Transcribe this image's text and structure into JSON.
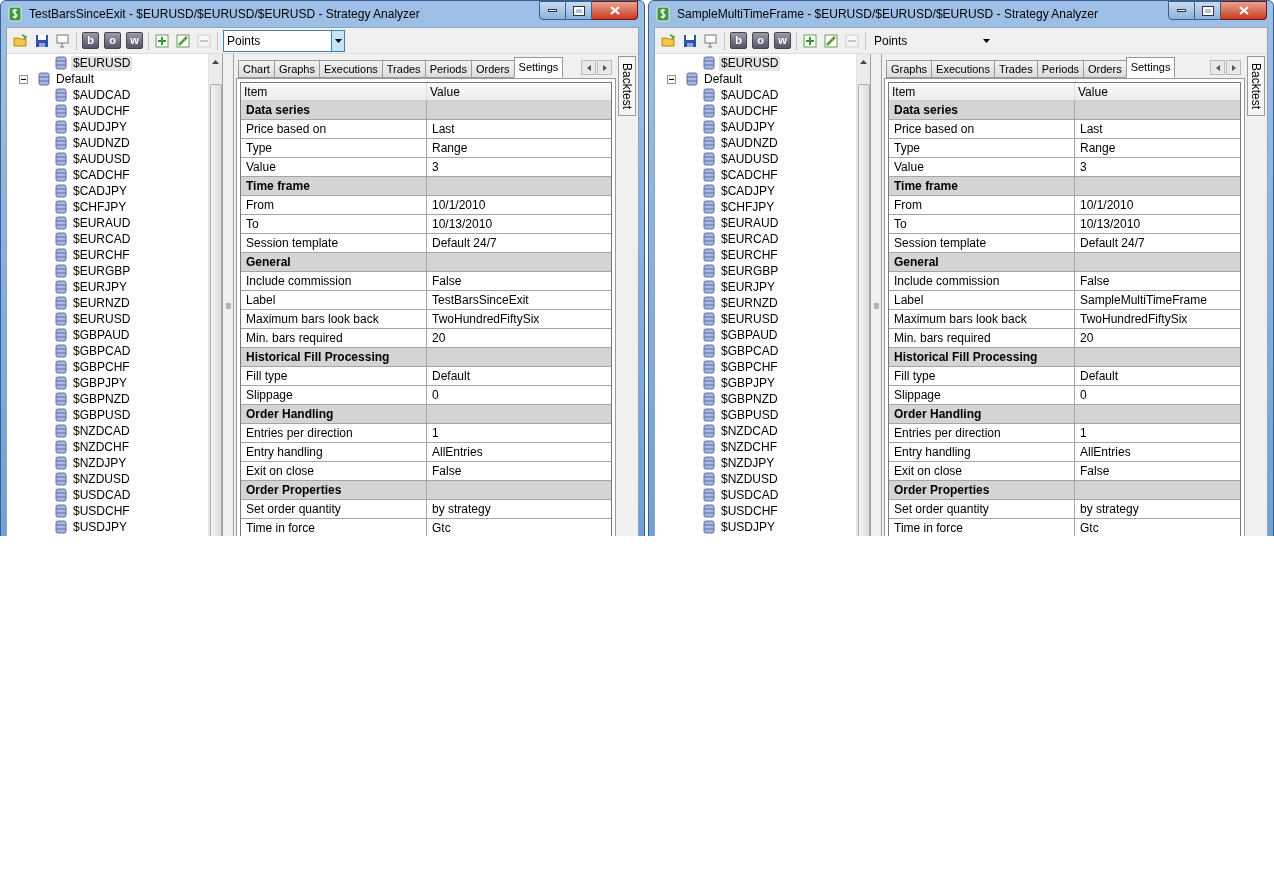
{
  "windows": [
    {
      "title": "TestBarsSinceExit - $EURUSD/$EURUSD/$EURUSD - Strategy Analyzer",
      "toolbar": {
        "letter_buttons": [
          "b",
          "o",
          "w"
        ],
        "remove_disabled": true,
        "combo": {
          "value": "Points",
          "focused": true
        }
      },
      "tree": [
        {
          "children": [
            {
              "label": "$EURUSD",
              "selected": true
            }
          ]
        },
        {
          "label": "Default",
          "expanded": true,
          "selected": false,
          "children": [
            {
              "label": "$AUDCAD",
              "selected": false
            },
            {
              "label": "$AUDCHF",
              "selected": false
            },
            {
              "label": "$AUDJPY",
              "selected": false
            },
            {
              "label": "$AUDNZD",
              "selected": false
            },
            {
              "label": "$AUDUSD",
              "selected": false
            },
            {
              "label": "$CADCHF",
              "selected": false
            },
            {
              "label": "$CADJPY",
              "selected": false
            },
            {
              "label": "$CHFJPY",
              "selected": false
            },
            {
              "label": "$EURAUD",
              "selected": false
            },
            {
              "label": "$EURCAD",
              "selected": false
            },
            {
              "label": "$EURCHF",
              "selected": false
            },
            {
              "label": "$EURGBP",
              "selected": false
            },
            {
              "label": "$EURJPY",
              "selected": false
            },
            {
              "label": "$EURNZD",
              "selected": false
            },
            {
              "label": "$EURUSD",
              "selected": false
            },
            {
              "label": "$GBPAUD",
              "selected": false
            },
            {
              "label": "$GBPCAD",
              "selected": false
            },
            {
              "label": "$GBPCHF",
              "selected": false
            },
            {
              "label": "$GBPJPY",
              "selected": false
            },
            {
              "label": "$GBPNZD",
              "selected": false
            },
            {
              "label": "$GBPUSD",
              "selected": false
            },
            {
              "label": "$NZDCAD",
              "selected": false
            },
            {
              "label": "$NZDCHF",
              "selected": false
            },
            {
              "label": "$NZDJPY",
              "selected": false
            },
            {
              "label": "$NZDUSD",
              "selected": false
            },
            {
              "label": "$USDCAD",
              "selected": false
            },
            {
              "label": "$USDCHF",
              "selected": false
            },
            {
              "label": "$USDJPY",
              "selected": false
            }
          ]
        }
      ],
      "tabs": [
        {
          "label": "Chart",
          "selected": false
        },
        {
          "label": "Graphs",
          "selected": false
        },
        {
          "label": "Executions",
          "selected": false
        },
        {
          "label": "Trades",
          "selected": false
        },
        {
          "label": "Periods",
          "selected": false
        },
        {
          "label": "Orders",
          "selected": false
        },
        {
          "label": "Settings",
          "selected": true
        }
      ],
      "grid": {
        "columns": [
          "Item",
          "Value"
        ],
        "rows": [
          {
            "kind": "section",
            "item": "Data series"
          },
          {
            "kind": "property",
            "item": "Price based on",
            "value": "Last"
          },
          {
            "kind": "property",
            "item": "Type",
            "value": "Range"
          },
          {
            "kind": "property",
            "item": "Value",
            "value": "3"
          },
          {
            "kind": "section",
            "item": "Time frame"
          },
          {
            "kind": "property",
            "item": "From",
            "value": "10/1/2010"
          },
          {
            "kind": "property",
            "item": "To",
            "value": "10/13/2010"
          },
          {
            "kind": "property",
            "item": "Session template",
            "value": "Default 24/7"
          },
          {
            "kind": "section",
            "item": "General"
          },
          {
            "kind": "property",
            "item": "Include commission",
            "value": "False"
          },
          {
            "kind": "property",
            "item": "Label",
            "value": "TestBarsSinceExit"
          },
          {
            "kind": "property",
            "item": "Maximum bars look back",
            "value": "TwoHundredFiftySix"
          },
          {
            "kind": "property",
            "item": "Min. bars required",
            "value": "20"
          },
          {
            "kind": "section",
            "item": "Historical Fill Processing"
          },
          {
            "kind": "property",
            "item": "Fill type",
            "value": "Default"
          },
          {
            "kind": "property",
            "item": "Slippage",
            "value": "0"
          },
          {
            "kind": "section",
            "item": "Order Handling"
          },
          {
            "kind": "property",
            "item": "Entries per direction",
            "value": "1"
          },
          {
            "kind": "property",
            "item": "Entry handling",
            "value": "AllEntries"
          },
          {
            "kind": "property",
            "item": "Exit on close",
            "value": "False"
          },
          {
            "kind": "section",
            "item": "Order Properties"
          },
          {
            "kind": "property",
            "item": "Set order quantity",
            "value": "by strategy"
          },
          {
            "kind": "property",
            "item": "Time in force",
            "value": "Gtc"
          }
        ]
      },
      "side_tab": "Backtest"
    },
    {
      "title": "SampleMultiTimeFrame - $EURUSD/$EURUSD/$EURUSD - Strategy Analyzer",
      "toolbar": {
        "letter_buttons": [
          "b",
          "o",
          "w"
        ],
        "remove_disabled": true,
        "combo": {
          "value": "Points",
          "focused": false
        }
      },
      "tree": [
        {
          "children": [
            {
              "label": "$EURUSD",
              "selected": true
            }
          ]
        },
        {
          "label": "Default",
          "expanded": true,
          "selected": false,
          "children": [
            {
              "label": "$AUDCAD",
              "selected": false
            },
            {
              "label": "$AUDCHF",
              "selected": false
            },
            {
              "label": "$AUDJPY",
              "selected": false
            },
            {
              "label": "$AUDNZD",
              "selected": false
            },
            {
              "label": "$AUDUSD",
              "selected": false
            },
            {
              "label": "$CADCHF",
              "selected": false
            },
            {
              "label": "$CADJPY",
              "selected": false
            },
            {
              "label": "$CHFJPY",
              "selected": false
            },
            {
              "label": "$EURAUD",
              "selected": false
            },
            {
              "label": "$EURCAD",
              "selected": false
            },
            {
              "label": "$EURCHF",
              "selected": false
            },
            {
              "label": "$EURGBP",
              "selected": false
            },
            {
              "label": "$EURJPY",
              "selected": false
            },
            {
              "label": "$EURNZD",
              "selected": false
            },
            {
              "label": "$EURUSD",
              "selected": false
            },
            {
              "label": "$GBPAUD",
              "selected": false
            },
            {
              "label": "$GBPCAD",
              "selected": false
            },
            {
              "label": "$GBPCHF",
              "selected": false
            },
            {
              "label": "$GBPJPY",
              "selected": false
            },
            {
              "label": "$GBPNZD",
              "selected": false
            },
            {
              "label": "$GBPUSD",
              "selected": false
            },
            {
              "label": "$NZDCAD",
              "selected": false
            },
            {
              "label": "$NZDCHF",
              "selected": false
            },
            {
              "label": "$NZDJPY",
              "selected": false
            },
            {
              "label": "$NZDUSD",
              "selected": false
            },
            {
              "label": "$USDCAD",
              "selected": false
            },
            {
              "label": "$USDCHF",
              "selected": false
            },
            {
              "label": "$USDJPY",
              "selected": false
            }
          ]
        }
      ],
      "tabs": [
        {
          "label": "Graphs",
          "selected": false
        },
        {
          "label": "Executions",
          "selected": false
        },
        {
          "label": "Trades",
          "selected": false
        },
        {
          "label": "Periods",
          "selected": false
        },
        {
          "label": "Orders",
          "selected": false
        },
        {
          "label": "Settings",
          "selected": true
        }
      ],
      "grid": {
        "columns": [
          "Item",
          "Value"
        ],
        "rows": [
          {
            "kind": "section",
            "item": "Data series"
          },
          {
            "kind": "property",
            "item": "Price based on",
            "value": "Last"
          },
          {
            "kind": "property",
            "item": "Type",
            "value": "Range"
          },
          {
            "kind": "property",
            "item": "Value",
            "value": "3"
          },
          {
            "kind": "section",
            "item": "Time frame"
          },
          {
            "kind": "property",
            "item": "From",
            "value": "10/1/2010"
          },
          {
            "kind": "property",
            "item": "To",
            "value": "10/13/2010"
          },
          {
            "kind": "property",
            "item": "Session template",
            "value": "Default 24/7"
          },
          {
            "kind": "section",
            "item": "General"
          },
          {
            "kind": "property",
            "item": "Include commission",
            "value": "False"
          },
          {
            "kind": "property",
            "item": "Label",
            "value": "SampleMultiTimeFrame"
          },
          {
            "kind": "property",
            "item": "Maximum bars look back",
            "value": "TwoHundredFiftySix"
          },
          {
            "kind": "property",
            "item": "Min. bars required",
            "value": "20"
          },
          {
            "kind": "section",
            "item": "Historical Fill Processing"
          },
          {
            "kind": "property",
            "item": "Fill type",
            "value": "Default"
          },
          {
            "kind": "property",
            "item": "Slippage",
            "value": "0"
          },
          {
            "kind": "section",
            "item": "Order Handling"
          },
          {
            "kind": "property",
            "item": "Entries per direction",
            "value": "1"
          },
          {
            "kind": "property",
            "item": "Entry handling",
            "value": "AllEntries"
          },
          {
            "kind": "property",
            "item": "Exit on close",
            "value": "False"
          },
          {
            "kind": "section",
            "item": "Order Properties"
          },
          {
            "kind": "property",
            "item": "Set order quantity",
            "value": "by strategy"
          },
          {
            "kind": "property",
            "item": "Time in force",
            "value": "Gtc"
          }
        ]
      },
      "side_tab": "Backtest"
    }
  ]
}
